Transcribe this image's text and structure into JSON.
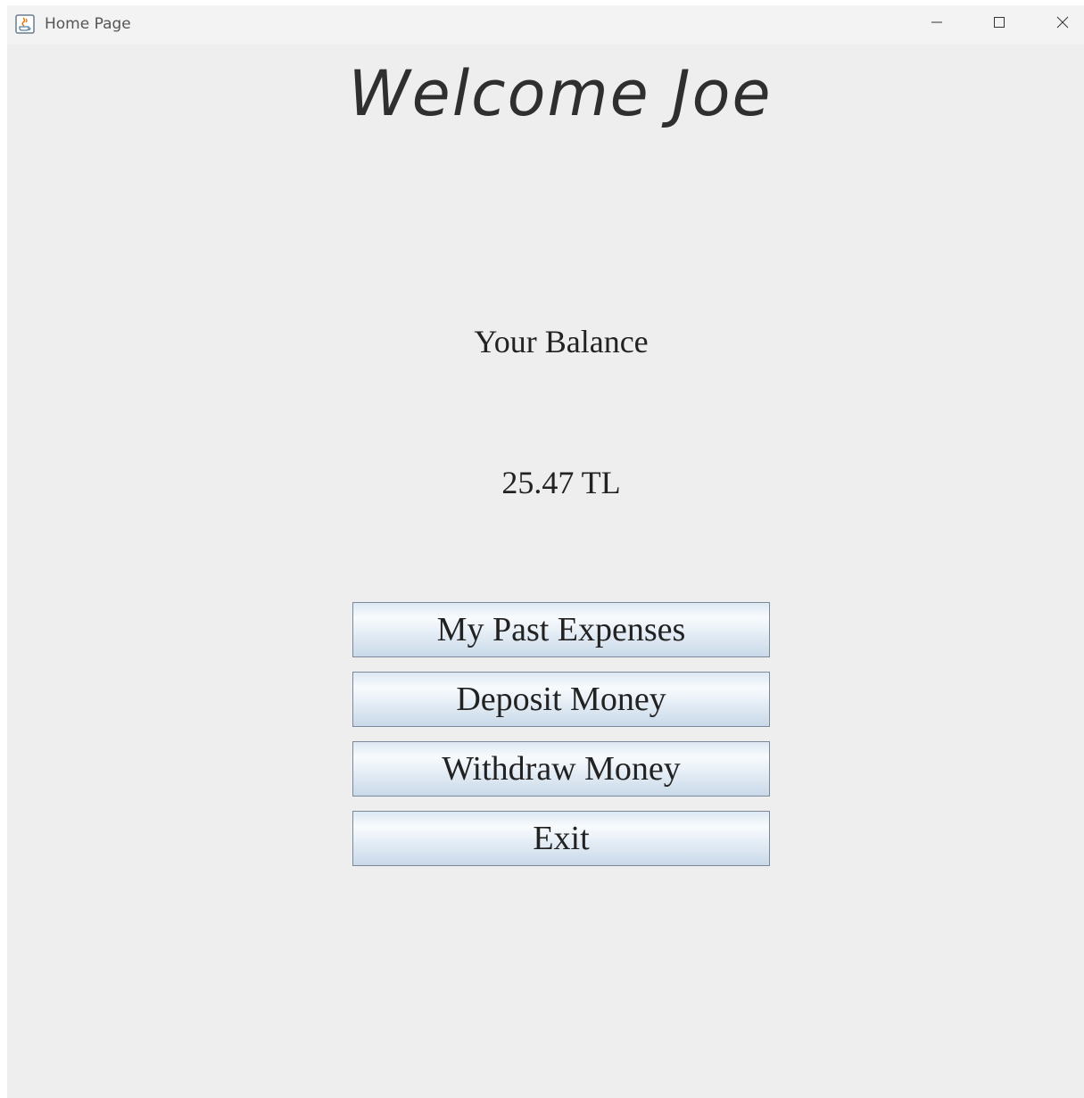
{
  "window": {
    "title": "Home Page",
    "icon": "java-cup-icon",
    "controls": [
      "minimize",
      "maximize",
      "close"
    ]
  },
  "main": {
    "welcome": "Welcome Joe",
    "balance_label": "Your Balance",
    "balance_value": "25.47 TL",
    "buttons": {
      "past_expenses": "My Past Expenses",
      "deposit": "Deposit Money",
      "withdraw": "Withdraw Money",
      "exit": "Exit"
    }
  },
  "colors": {
    "background": "#eeeeee",
    "titlebar": "#f3f3f3",
    "button_border": "#7a8a99",
    "text": "#222222"
  }
}
